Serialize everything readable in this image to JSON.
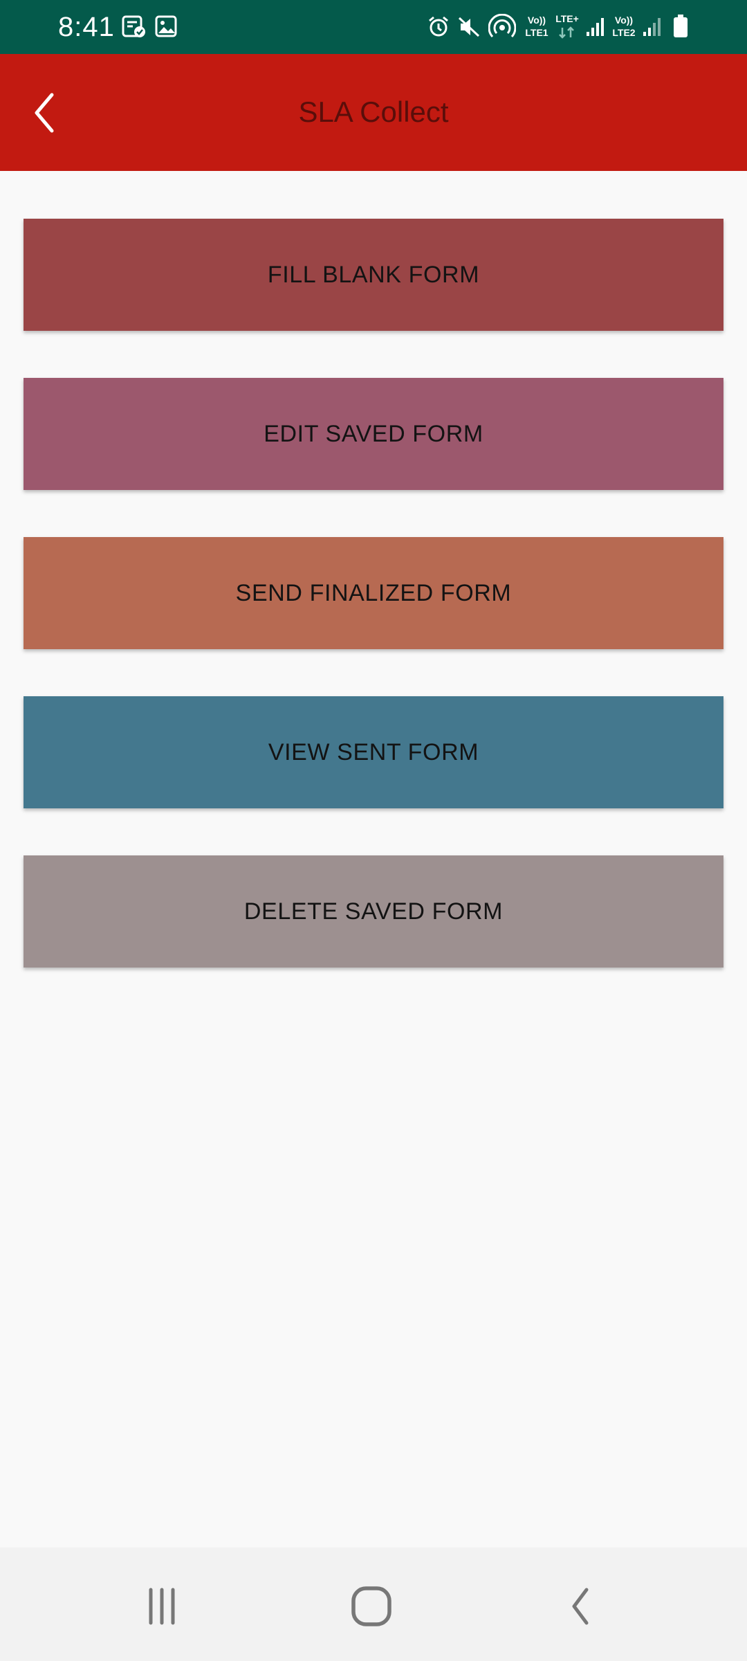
{
  "status_bar": {
    "time": "8:41",
    "sim1_top": "Vo))",
    "sim1_bottom": "LTE1",
    "lte_plus": "LTE+",
    "sim2_top": "Vo))",
    "sim2_bottom": "LTE2",
    "icons": [
      "notes-check-icon",
      "image-icon",
      "alarm-icon",
      "mute-icon",
      "hotspot-icon",
      "data-arrows-icon",
      "signal-1-icon",
      "signal-2-icon",
      "battery-icon"
    ]
  },
  "app_bar": {
    "title": "SLA Collect",
    "back_icon": "chevron-left-icon",
    "background": "#c21a11"
  },
  "menu": [
    {
      "label": "FILL BLANK FORM",
      "color": "#9a4546"
    },
    {
      "label": "EDIT SAVED FORM",
      "color": "#9c586d"
    },
    {
      "label": "SEND FINALIZED FORM",
      "color": "#b76a52"
    },
    {
      "label": "VIEW SENT FORM",
      "color": "#44788e"
    },
    {
      "label": "DELETE SAVED FORM",
      "color": "#9d9090"
    }
  ],
  "nav_bar": {
    "icons": [
      "recent-apps-icon",
      "home-icon",
      "back-icon"
    ]
  }
}
